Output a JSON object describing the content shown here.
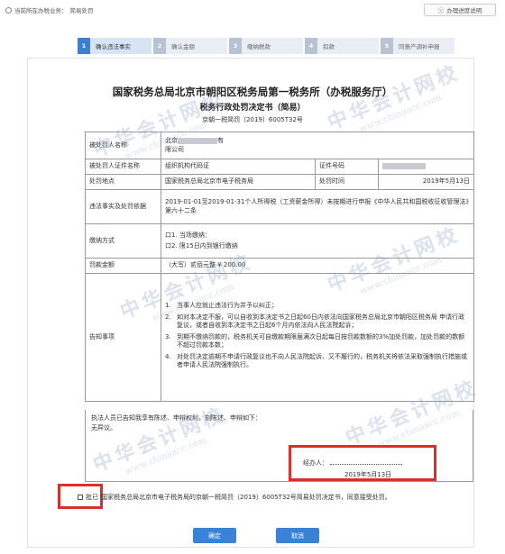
{
  "breadcrumb": {
    "items": [
      "当前所在办税业务：",
      "简易处罚"
    ]
  },
  "help": {
    "label": "办理进度说明"
  },
  "steps": [
    {
      "num": "1",
      "label": "确认违法事实",
      "active": true
    },
    {
      "num": "2",
      "label": "确认金额",
      "active": false
    },
    {
      "num": "3",
      "label": "缴纳税款",
      "active": false
    },
    {
      "num": "4",
      "label": "扣款",
      "active": false
    },
    {
      "num": "5",
      "label": "同意产调补申报",
      "active": false
    }
  ],
  "document": {
    "title": "国家税务总局北京市朝阳区税务局第一税务所（办税服务厅）",
    "subtitle": "税务行政处罚决定书（简易）",
    "number": "京朝一税简罚〔2019〕6005T32号"
  },
  "table": {
    "party_name_label": "被处罚人名称",
    "party_name_value_prefix": "北京",
    "party_name_value_suffix": "有",
    "party_name_value_line2": "限公司",
    "id_type_label": "被处罚人证件名称",
    "id_type_value": "组织机构代码证",
    "id_number_label": "证件号码",
    "location_label": "处罚地点",
    "location_value": "国家税务总局北京市电子税务局",
    "time_label": "处罚时间",
    "time_value": "2019年5月13日",
    "facts_label": "违法事实及处罚依据",
    "facts_value": "2019-01-01至2019-01-31个人所得税（工资薪金所得）未按期进行申报《中华人民共和国税收征收管理法》第六十二条",
    "payment_label": "缴纳方式",
    "payment_options": [
      "口1. 当场缴纳：",
      "口2. 限15日内到银行缴纳"
    ],
    "fine_label": "罚款金额",
    "fine_value": "（大写）贰佰元整 ¥ 200.00",
    "notice_label": "告知事项",
    "notices": [
      {
        "n": "1.",
        "text": "当事人应就止违法行为并予以纠正；"
      },
      {
        "n": "2.",
        "text": "如对本决定不服，可以自收到本决定书之日起60日内依法向国家税务总局北京市朝阳区税务局 申请行政复议，或者自收到本决定书之日起6个月内依法向人民法院起诉；"
      },
      {
        "n": "3.",
        "text": "到期不缴纳罚款的，税务机关可自缴款期限届满次日起每日按罚款数额的3%加处罚款，加处罚款的数额不超过罚款本数；"
      },
      {
        "n": "4.",
        "text": "对处罚决定逾期不申请行政复议也不向人民法院起诉、又不履行的，税务机关将依法采取强制执行措施或者申请人民法院强制执行。"
      }
    ]
  },
  "sign_area": {
    "line1": "执法人员已告知我享有陈述、申辩权利，刻陈述、申辩如下：",
    "line2": "无异议。",
    "signer_label": "经办人：",
    "sign_date": "2019年5月13日"
  },
  "batch": {
    "label": "批已",
    "text": "国家税务总局北京市电子税务局的京朝一税简罚（2019）6005T32号简易处罚决定书，同意接受处罚。"
  },
  "buttons": {
    "confirm": "确定",
    "cancel": "取消"
  },
  "watermark": {
    "cn": "中华会计网校",
    "en": "www.chinaacc.com"
  },
  "colors": {
    "accent": "#3a82d6",
    "highlight": "#d9302c",
    "step_bg": "#e9eef5"
  }
}
